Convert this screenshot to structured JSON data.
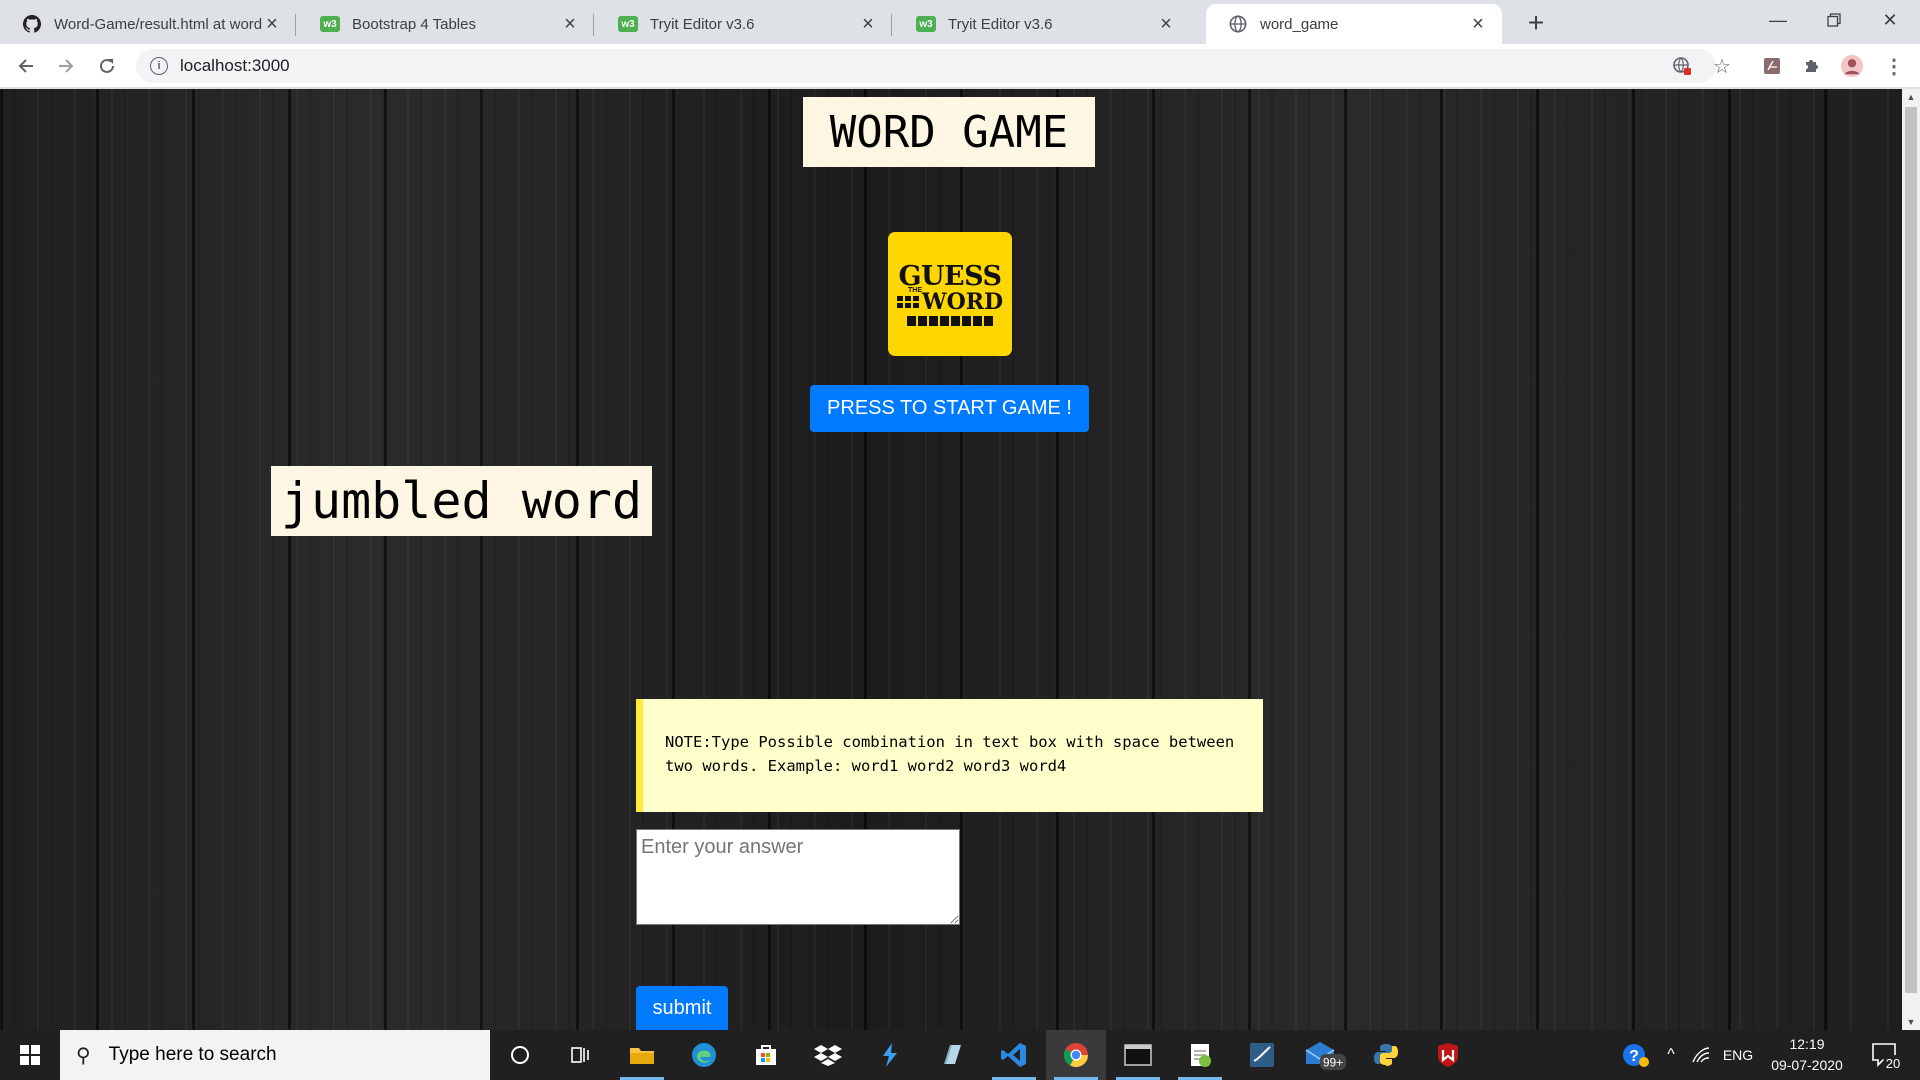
{
  "browser": {
    "tabs": [
      {
        "title": "Word-Game/result.html at word_",
        "icon": "github-icon",
        "active": false
      },
      {
        "title": "Bootstrap 4 Tables",
        "icon": "w3schools-icon",
        "active": false
      },
      {
        "title": "Tryit Editor v3.6",
        "icon": "w3schools-icon",
        "active": false
      },
      {
        "title": "Tryit Editor v3.6",
        "icon": "w3schools-icon",
        "active": false
      },
      {
        "title": "word_game",
        "icon": "globe-icon",
        "active": true
      }
    ],
    "w3_badge": "w3",
    "address": "localhost:3000"
  },
  "page": {
    "title": "WORD GAME",
    "logo": {
      "line1": "GUESS",
      "small": "THE",
      "line2": "WORD"
    },
    "start_button": "PRESS TO START GAME !",
    "jumbled_word": "jumbled word",
    "note": "NOTE:Type Possible combination in text box with space between two words. Example: word1 word2 word3 word4",
    "answer_placeholder": "Enter your answer",
    "submit_button": "submit",
    "colors": {
      "button": "#007bff",
      "note_bg": "#ffffcc",
      "note_border": "#ffeb3b",
      "logo_bg": "#ffd600"
    }
  },
  "taskbar": {
    "search_placeholder": "Type here to search",
    "mail_badge": "99+",
    "language": "ENG",
    "time": "12:19",
    "date": "09-07-2020",
    "notifications": "20"
  }
}
